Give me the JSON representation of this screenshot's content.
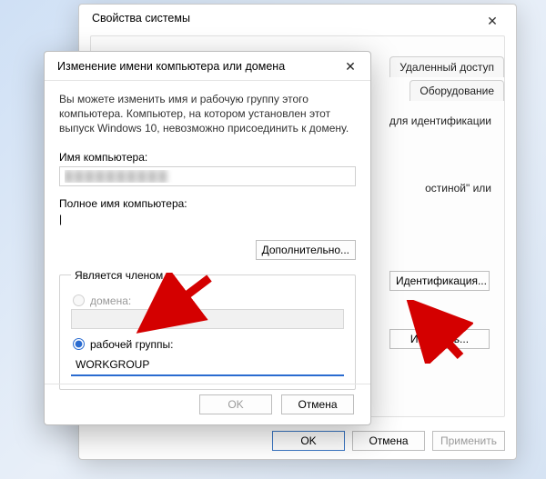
{
  "outer": {
    "title": "Свойства системы",
    "tabs": {
      "remote": "Удаленный доступ",
      "hardware": "Оборудование"
    },
    "partial_text1": "для идентификации",
    "partial_text2": "остиной\" или",
    "identify_btn": "Идентификация...",
    "change_btn": "Изменить...",
    "footer": {
      "ok": "OK",
      "cancel": "Отмена",
      "apply": "Применить"
    }
  },
  "inner": {
    "title": "Изменение имени компьютера или домена",
    "desc": "Вы можете изменить имя и рабочую группу этого компьютера. Компьютер, на котором установлен этот выпуск Windows 10, невозможно присоединить к домену.",
    "computer_name_label": "Имя компьютера:",
    "computer_name_value": "██████████",
    "full_name_label": "Полное имя компьютера:",
    "full_name_value": "",
    "more_btn": "Дополнительно...",
    "member_legend": "Является членом",
    "domain_label": "домена:",
    "workgroup_label": "рабочей группы:",
    "workgroup_value": "WORKGROUP",
    "footer": {
      "ok": "OK",
      "cancel": "Отмена"
    }
  }
}
